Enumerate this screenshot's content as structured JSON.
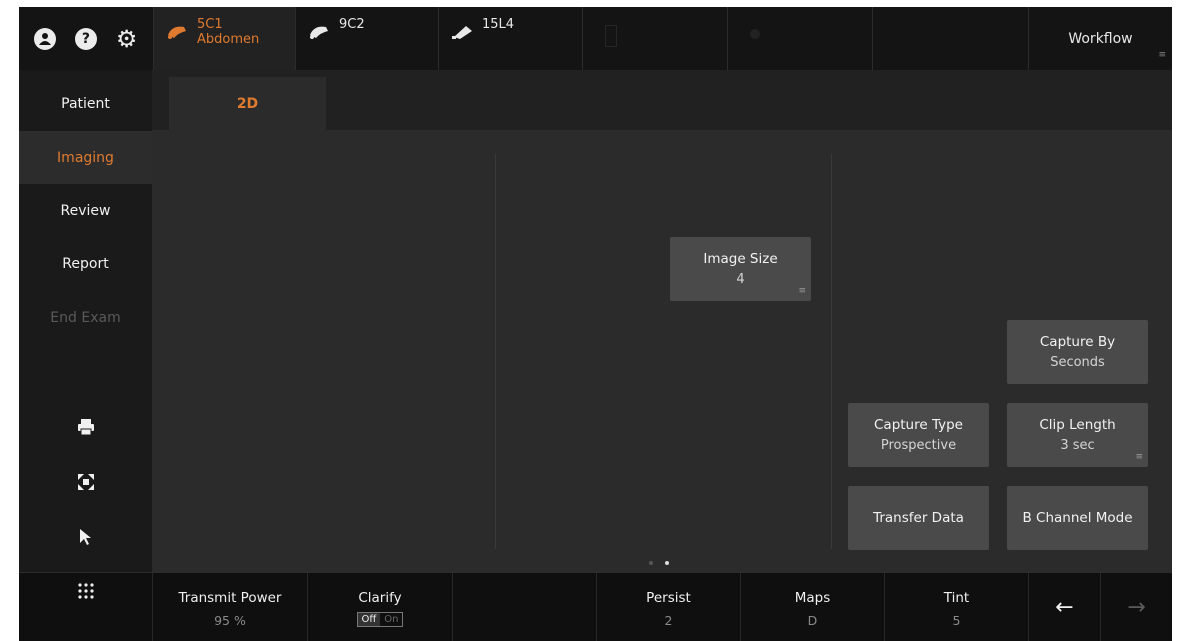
{
  "probes": [
    {
      "name": "5C1",
      "sub": "Abdomen",
      "active": true
    },
    {
      "name": "9C2",
      "sub": "",
      "active": false
    },
    {
      "name": "15L4",
      "sub": "",
      "active": false
    }
  ],
  "topbar": {
    "workflow_label": "Workflow",
    "workflow_menu_glyph": "≡"
  },
  "sidebar": {
    "items": [
      {
        "label": "Patient",
        "state": "normal"
      },
      {
        "label": "Imaging",
        "state": "active"
      },
      {
        "label": "Review",
        "state": "normal"
      },
      {
        "label": "Report",
        "state": "normal"
      },
      {
        "label": "End Exam",
        "state": "disabled"
      }
    ],
    "icons": [
      "print-icon",
      "fullscreen-icon",
      "pointer-icon"
    ]
  },
  "mode_tab": {
    "label": "2D"
  },
  "controls": {
    "image_size": {
      "label": "Image Size",
      "value": "4",
      "glyph": "≡"
    },
    "capture_by": {
      "label": "Capture By",
      "value": "Seconds"
    },
    "capture_type": {
      "label": "Capture Type",
      "value": "Prospective"
    },
    "clip_length": {
      "label": "Clip Length",
      "value": "3 sec",
      "glyph": "≡"
    },
    "transfer_data": {
      "label": "Transfer Data"
    },
    "b_channel_mode": {
      "label": "B Channel Mode"
    }
  },
  "pager": {
    "pages": 2,
    "current": 2
  },
  "bottom": {
    "transmit_power": {
      "label": "Transmit Power",
      "value": "95 %"
    },
    "clarify": {
      "label": "Clarify",
      "off": "Off",
      "on": "On",
      "selected": "Off"
    },
    "persist": {
      "label": "Persist",
      "value": "2"
    },
    "maps": {
      "label": "Maps",
      "value": "D"
    },
    "tint": {
      "label": "Tint",
      "value": "5"
    },
    "back_glyph": "←",
    "forward_glyph": "→"
  },
  "colors": {
    "accent": "#e07a2f",
    "background": "#2b2b2b",
    "control": "#4a4a4a"
  }
}
